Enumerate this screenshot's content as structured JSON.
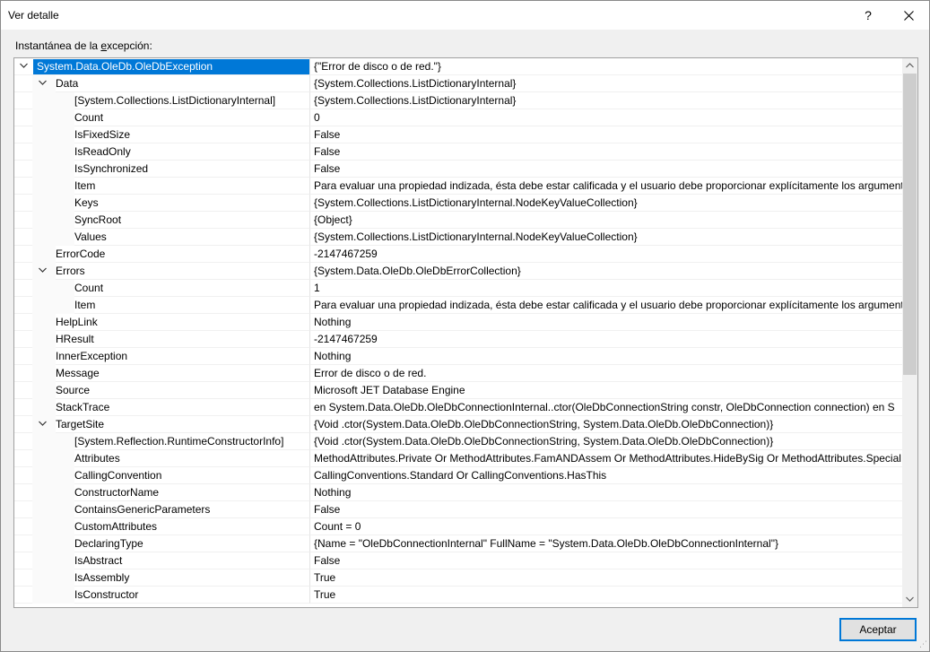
{
  "window": {
    "title": "Ver detalle",
    "help_label": "?",
    "close_label": "✕"
  },
  "group": {
    "label_prefix": "Instantánea de la ",
    "label_underlined": "e",
    "label_suffix": "xcepción:"
  },
  "tree": {
    "rows": [
      {
        "level": 0,
        "toggle": "expanded",
        "selected": true,
        "name": "System.Data.OleDb.OleDbException",
        "value": "{\"Error de disco o de red.\"}"
      },
      {
        "level": 1,
        "toggle": "expanded",
        "name": "Data",
        "value": "{System.Collections.ListDictionaryInternal}"
      },
      {
        "level": 2,
        "toggle": "none",
        "name": "[System.Collections.ListDictionaryInternal]",
        "value": "{System.Collections.ListDictionaryInternal}"
      },
      {
        "level": 2,
        "toggle": "none",
        "name": "Count",
        "value": "0"
      },
      {
        "level": 2,
        "toggle": "none",
        "name": "IsFixedSize",
        "value": "False"
      },
      {
        "level": 2,
        "toggle": "none",
        "name": "IsReadOnly",
        "value": "False"
      },
      {
        "level": 2,
        "toggle": "none",
        "name": "IsSynchronized",
        "value": "False"
      },
      {
        "level": 2,
        "toggle": "none",
        "name": "Item",
        "value": "Para evaluar una propiedad indizada, ésta debe estar calificada y el usuario debe proporcionar explícitamente los argumentos"
      },
      {
        "level": 2,
        "toggle": "none",
        "name": "Keys",
        "value": "{System.Collections.ListDictionaryInternal.NodeKeyValueCollection}"
      },
      {
        "level": 2,
        "toggle": "none",
        "name": "SyncRoot",
        "value": "{Object}"
      },
      {
        "level": 2,
        "toggle": "none",
        "name": "Values",
        "value": "{System.Collections.ListDictionaryInternal.NodeKeyValueCollection}"
      },
      {
        "level": 1,
        "toggle": "none",
        "name": "ErrorCode",
        "value": "-2147467259"
      },
      {
        "level": 1,
        "toggle": "expanded",
        "name": "Errors",
        "value": "{System.Data.OleDb.OleDbErrorCollection}"
      },
      {
        "level": 2,
        "toggle": "none",
        "name": "Count",
        "value": "1"
      },
      {
        "level": 2,
        "toggle": "none",
        "name": "Item",
        "value": "Para evaluar una propiedad indizada, ésta debe estar calificada y el usuario debe proporcionar explícitamente los argumentos"
      },
      {
        "level": 1,
        "toggle": "none",
        "name": "HelpLink",
        "value": "Nothing"
      },
      {
        "level": 1,
        "toggle": "none",
        "name": "HResult",
        "value": "-2147467259"
      },
      {
        "level": 1,
        "toggle": "none",
        "name": "InnerException",
        "value": "Nothing"
      },
      {
        "level": 1,
        "toggle": "none",
        "name": "Message",
        "value": "Error de disco o de red."
      },
      {
        "level": 1,
        "toggle": "none",
        "name": "Source",
        "value": "Microsoft JET Database Engine"
      },
      {
        "level": 1,
        "toggle": "none",
        "name": "StackTrace",
        "value": "   en System.Data.OleDb.OleDbConnectionInternal..ctor(OleDbConnectionString constr, OleDbConnection connection)    en S"
      },
      {
        "level": 1,
        "toggle": "expanded",
        "name": "TargetSite",
        "value": "{Void .ctor(System.Data.OleDb.OleDbConnectionString, System.Data.OleDb.OleDbConnection)}"
      },
      {
        "level": 2,
        "toggle": "none",
        "name": "[System.Reflection.RuntimeConstructorInfo]",
        "value": "{Void .ctor(System.Data.OleDb.OleDbConnectionString, System.Data.OleDb.OleDbConnection)}"
      },
      {
        "level": 2,
        "toggle": "none",
        "name": "Attributes",
        "value": "MethodAttributes.Private Or MethodAttributes.FamANDAssem Or MethodAttributes.HideBySig Or MethodAttributes.Special"
      },
      {
        "level": 2,
        "toggle": "none",
        "name": "CallingConvention",
        "value": "CallingConventions.Standard Or CallingConventions.HasThis"
      },
      {
        "level": 2,
        "toggle": "none",
        "name": "ConstructorName",
        "value": "Nothing"
      },
      {
        "level": 2,
        "toggle": "none",
        "name": "ContainsGenericParameters",
        "value": "False"
      },
      {
        "level": 2,
        "toggle": "none",
        "name": "CustomAttributes",
        "value": "Count = 0"
      },
      {
        "level": 2,
        "toggle": "none",
        "name": "DeclaringType",
        "value": "{Name = \"OleDbConnectionInternal\" FullName = \"System.Data.OleDb.OleDbConnectionInternal\"}"
      },
      {
        "level": 2,
        "toggle": "none",
        "name": "IsAbstract",
        "value": "False"
      },
      {
        "level": 2,
        "toggle": "none",
        "name": "IsAssembly",
        "value": "True"
      },
      {
        "level": 2,
        "toggle": "none",
        "name": "IsConstructor",
        "value": "True"
      }
    ]
  },
  "scrollbar": {
    "up_icon": "chevron-up-icon",
    "down_icon": "chevron-down-icon"
  },
  "buttons": {
    "ok_label": "Aceptar"
  },
  "colors": {
    "selection": "#0078d7",
    "window_bg": "#f0f0f0"
  }
}
